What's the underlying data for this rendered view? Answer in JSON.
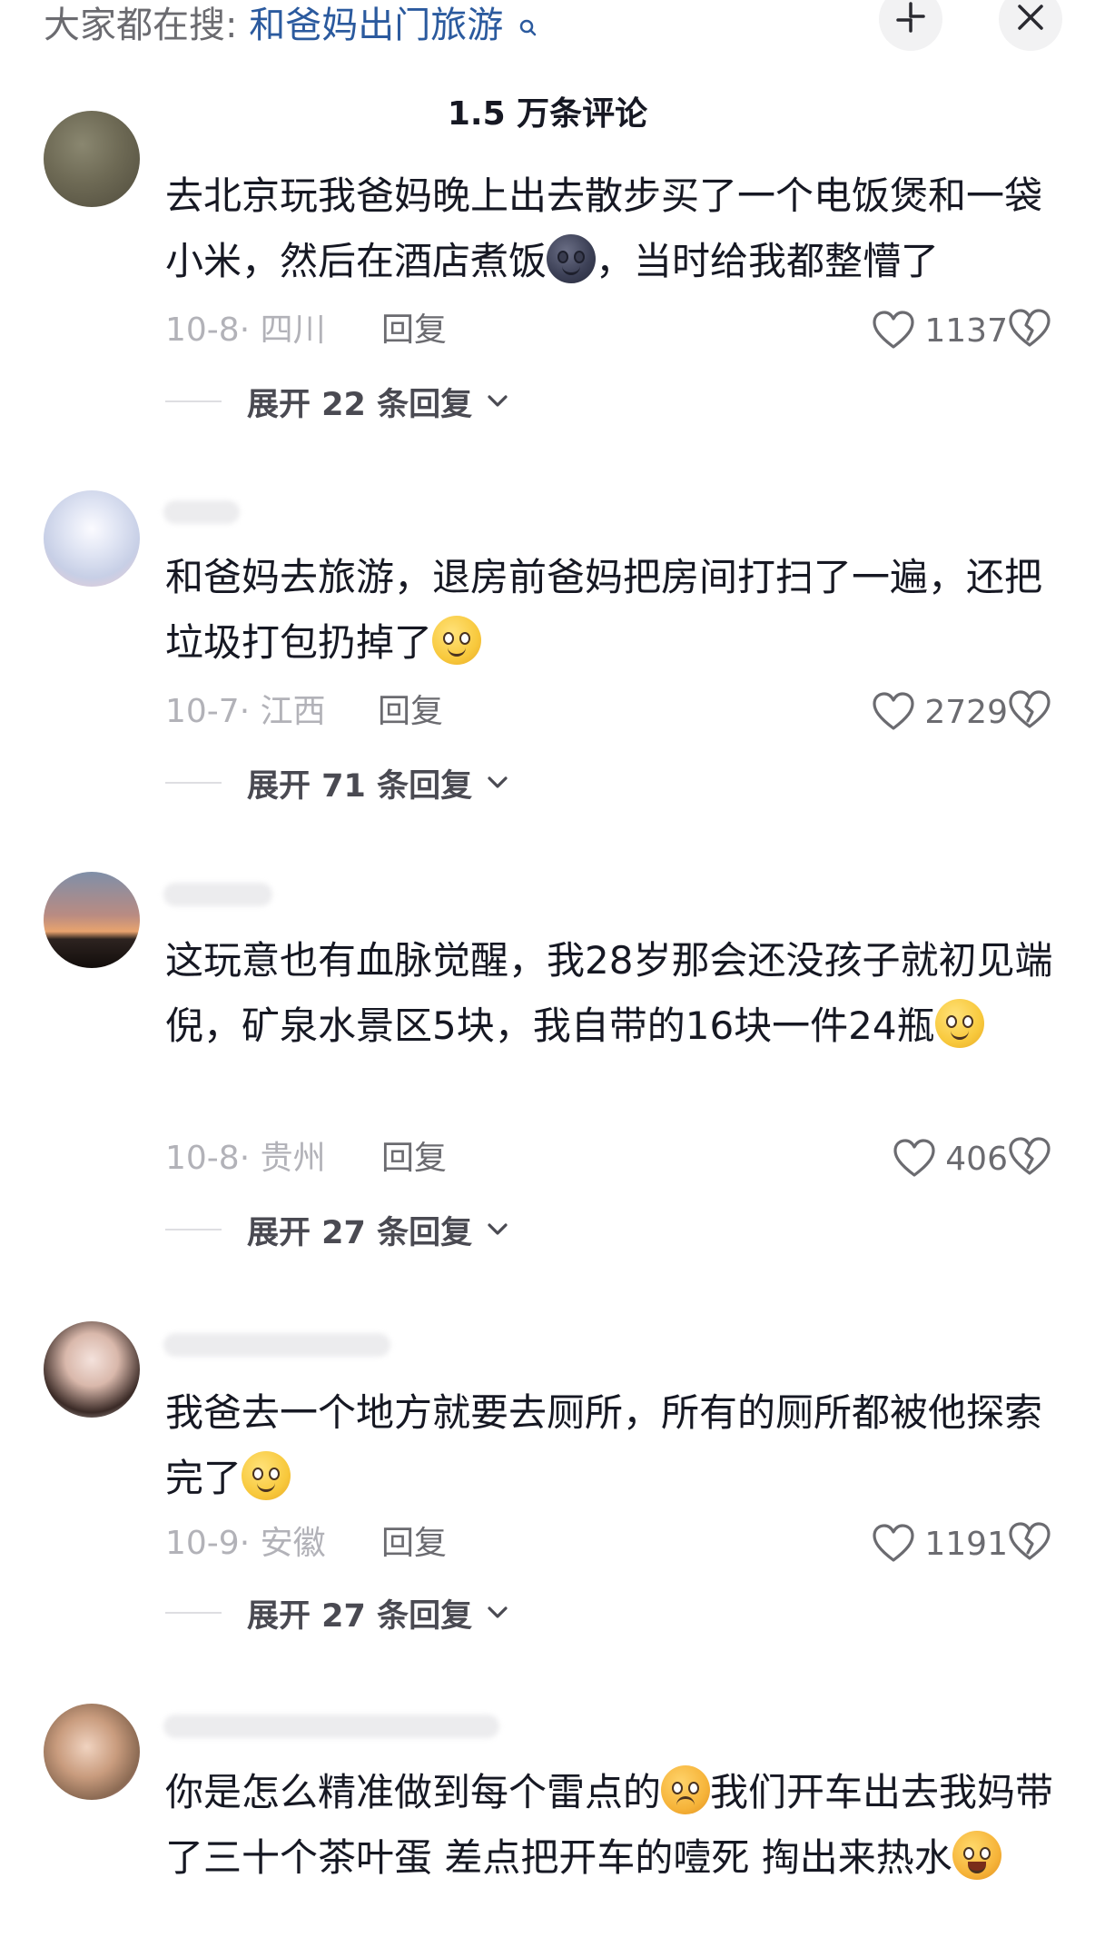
{
  "header": {
    "search_prefix": "大家都在搜:",
    "search_term": "和爸妈出门旅游",
    "comment_count": "1.5 万条评论"
  },
  "comments": [
    {
      "text_before": "去北京玩我爸妈晚上出去散步买了一个电饭煲和一袋小米，然后在酒店煮饭",
      "emoji": "new-moon-face-emoji",
      "text_after": "，当时给我都整懵了",
      "date": "10-8",
      "location": "· 四川",
      "reply_label": "回复",
      "likes": "1137",
      "expand_label": "展开 22 条回复"
    },
    {
      "text_before": "和爸妈去旅游，退房前爸妈把房间打扫了一遍，还把垃圾打包扔掉了",
      "emoji": "thinking-face-emoji",
      "text_after": "",
      "date": "10-7",
      "location": "· 江西",
      "reply_label": "回复",
      "likes": "2729",
      "expand_label": "展开 71 条回复"
    },
    {
      "text_before": "这玩意也有血脉觉醒，我28岁那会还没孩子就初见端倪，矿泉水景区5块，我自带的16块一件24瓶",
      "emoji": "smile-face-emoji",
      "text_after": "",
      "date": "10-8",
      "location": "· 贵州",
      "reply_label": "回复",
      "likes": "406",
      "expand_label": "展开 27 条回复"
    },
    {
      "text_before": "我爸去一个地方就要去厕所，所有的厕所都被他探索完了",
      "emoji": "smile-face-emoji",
      "text_after": "",
      "date": "10-9",
      "location": "· 安徽",
      "reply_label": "回复",
      "likes": "1191",
      "expand_label": "展开 27 条回复"
    },
    {
      "text_before": "你是怎么精准做到每个雷点的",
      "emoji": "frowning-face-emoji",
      "text_middle": "我们开车出去我妈带了三十个茶叶蛋 差点把开车的噎死 掏出来热水",
      "emoji2": "laughing-tears-emoji"
    }
  ]
}
